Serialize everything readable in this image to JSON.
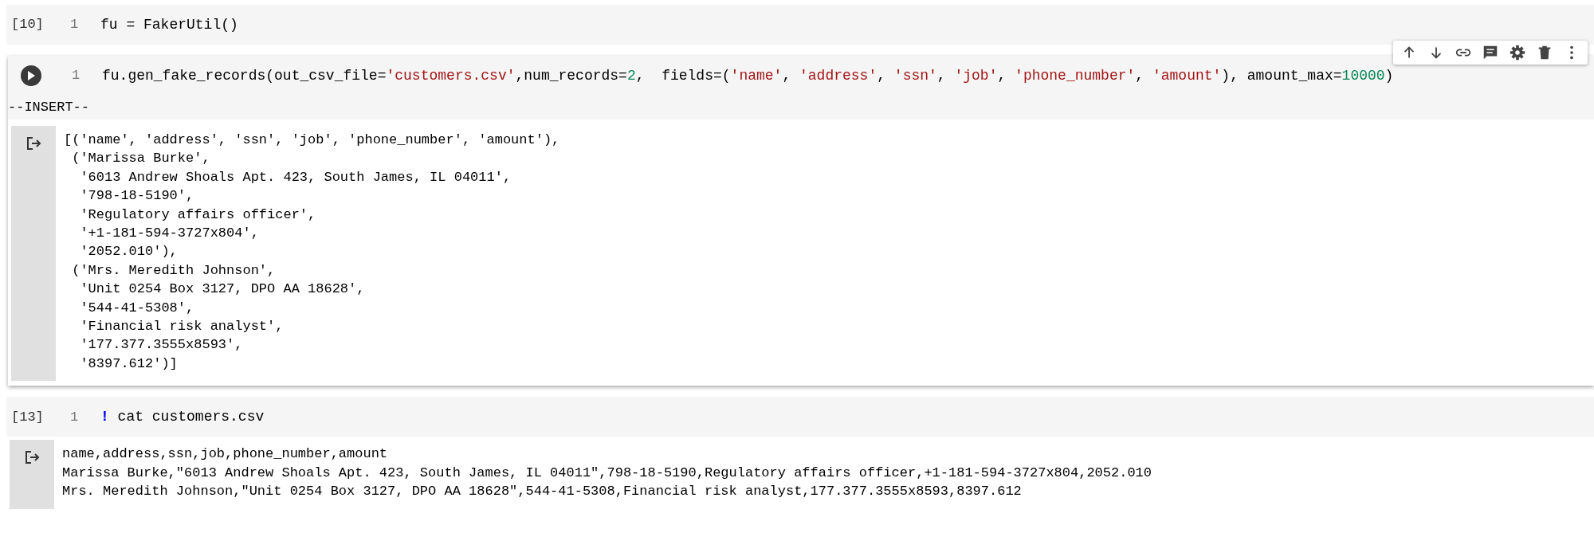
{
  "cells": [
    {
      "execution_count": "[10]",
      "focused": false,
      "lines": [
        {
          "number": "1",
          "tokens": [
            {
              "kind": "text",
              "text": "fu = FakerUtil()"
            }
          ]
        }
      ]
    },
    {
      "focused": true,
      "mode": "--INSERT--",
      "lines": [
        {
          "number": "1",
          "tokens": [
            {
              "kind": "text",
              "text": "fu.gen_fake_records(out_csv_file="
            },
            {
              "kind": "string",
              "text": "'customers.csv'"
            },
            {
              "kind": "text",
              "text": ",num_records="
            },
            {
              "kind": "number",
              "text": "2"
            },
            {
              "kind": "text",
              "text": ",  fields=("
            },
            {
              "kind": "string",
              "text": "'name'"
            },
            {
              "kind": "text",
              "text": ", "
            },
            {
              "kind": "string",
              "text": "'address'"
            },
            {
              "kind": "text",
              "text": ", "
            },
            {
              "kind": "string",
              "text": "'ssn'"
            },
            {
              "kind": "text",
              "text": ", "
            },
            {
              "kind": "string",
              "text": "'job'"
            },
            {
              "kind": "text",
              "text": ", "
            },
            {
              "kind": "string",
              "text": "'phone_number'"
            },
            {
              "kind": "text",
              "text": ", "
            },
            {
              "kind": "string",
              "text": "'amount'"
            },
            {
              "kind": "text",
              "text": "), amount_max="
            },
            {
              "kind": "number",
              "text": "10000"
            },
            {
              "kind": "text",
              "text": ")"
            }
          ]
        }
      ],
      "output": [
        "[('name', 'address', 'ssn', 'job', 'phone_number', 'amount'),",
        " ('Marissa Burke',",
        "  '6013 Andrew Shoals Apt. 423, South James, IL 04011',",
        "  '798-18-5190',",
        "  'Regulatory affairs officer',",
        "  '+1-181-594-3727x804',",
        "  '2052.010'),",
        " ('Mrs. Meredith Johnson',",
        "  'Unit 0254 Box 3127, DPO AA 18628',",
        "  '544-41-5308',",
        "  'Financial risk analyst',",
        "  '177.377.3555x8593',",
        "  '8397.612')]"
      ]
    },
    {
      "execution_count": "[13]",
      "focused": false,
      "lines": [
        {
          "number": "1",
          "tokens": [
            {
              "kind": "command",
              "text": "!"
            },
            {
              "kind": "text",
              "text": " cat customers.csv"
            }
          ]
        }
      ],
      "output": [
        "name,address,ssn,job,phone_number,amount",
        "Marissa Burke,\"6013 Andrew Shoals Apt. 423, South James, IL 04011\",798-18-5190,Regulatory affairs officer,+1-181-594-3727x804,2052.010",
        "Mrs. Meredith Johnson,\"Unit 0254 Box 3127, DPO AA 18628\",544-41-5308,Financial risk analyst,177.377.3555x8593,8397.612"
      ]
    }
  ]
}
